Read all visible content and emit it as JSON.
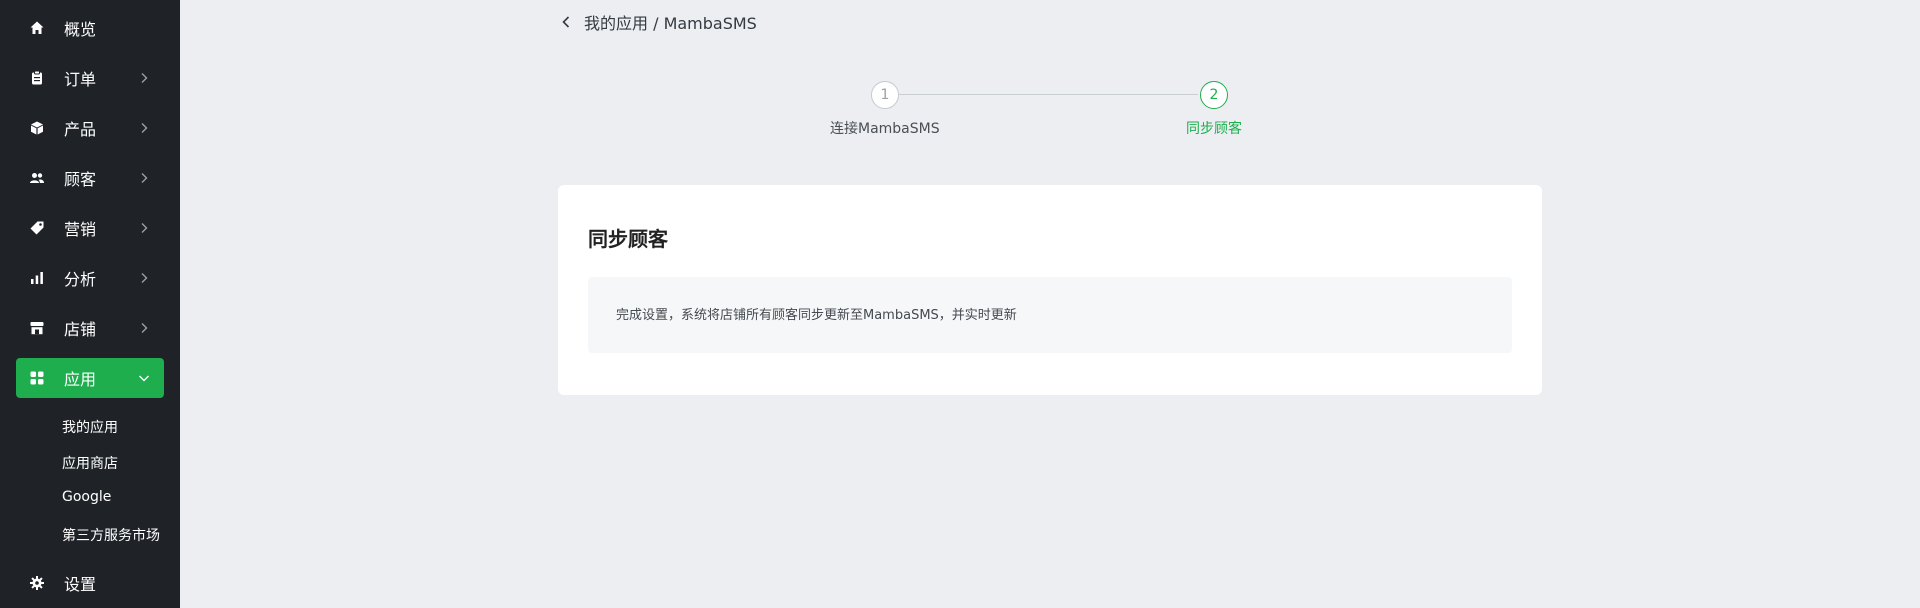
{
  "sidebar": {
    "items": [
      {
        "label": "概览",
        "icon": "home-icon",
        "has_chevron": false
      },
      {
        "label": "订单",
        "icon": "clipboard-icon",
        "has_chevron": true
      },
      {
        "label": "产品",
        "icon": "box-icon",
        "has_chevron": true
      },
      {
        "label": "顾客",
        "icon": "users-icon",
        "has_chevron": true
      },
      {
        "label": "营销",
        "icon": "tag-icon",
        "has_chevron": true
      },
      {
        "label": "分析",
        "icon": "bar-chart-icon",
        "has_chevron": true
      },
      {
        "label": "店铺",
        "icon": "store-icon",
        "has_chevron": true
      },
      {
        "label": "应用",
        "icon": "apps-icon",
        "has_chevron": true,
        "active": true,
        "expanded": true
      },
      {
        "label": "设置",
        "icon": "gear-icon",
        "has_chevron": false
      }
    ],
    "sub_items": [
      {
        "label": "我的应用"
      },
      {
        "label": "应用商店"
      },
      {
        "label": "Google"
      },
      {
        "label": "第三方服务市场"
      }
    ],
    "active_color": "#1eae4e",
    "background_color": "#1f2328"
  },
  "breadcrumb": {
    "text": "我的应用 / MambaSMS"
  },
  "stepper": {
    "steps": [
      {
        "number": "1",
        "label": "连接MambaSMS",
        "state": "done"
      },
      {
        "number": "2",
        "label": "同步顾客",
        "state": "current"
      }
    ],
    "accent_color": "#1eae4e"
  },
  "card": {
    "title": "同步顾客",
    "info": "完成设置，系统将店铺所有顾客同步更新至MambaSMS，并实时更新"
  }
}
